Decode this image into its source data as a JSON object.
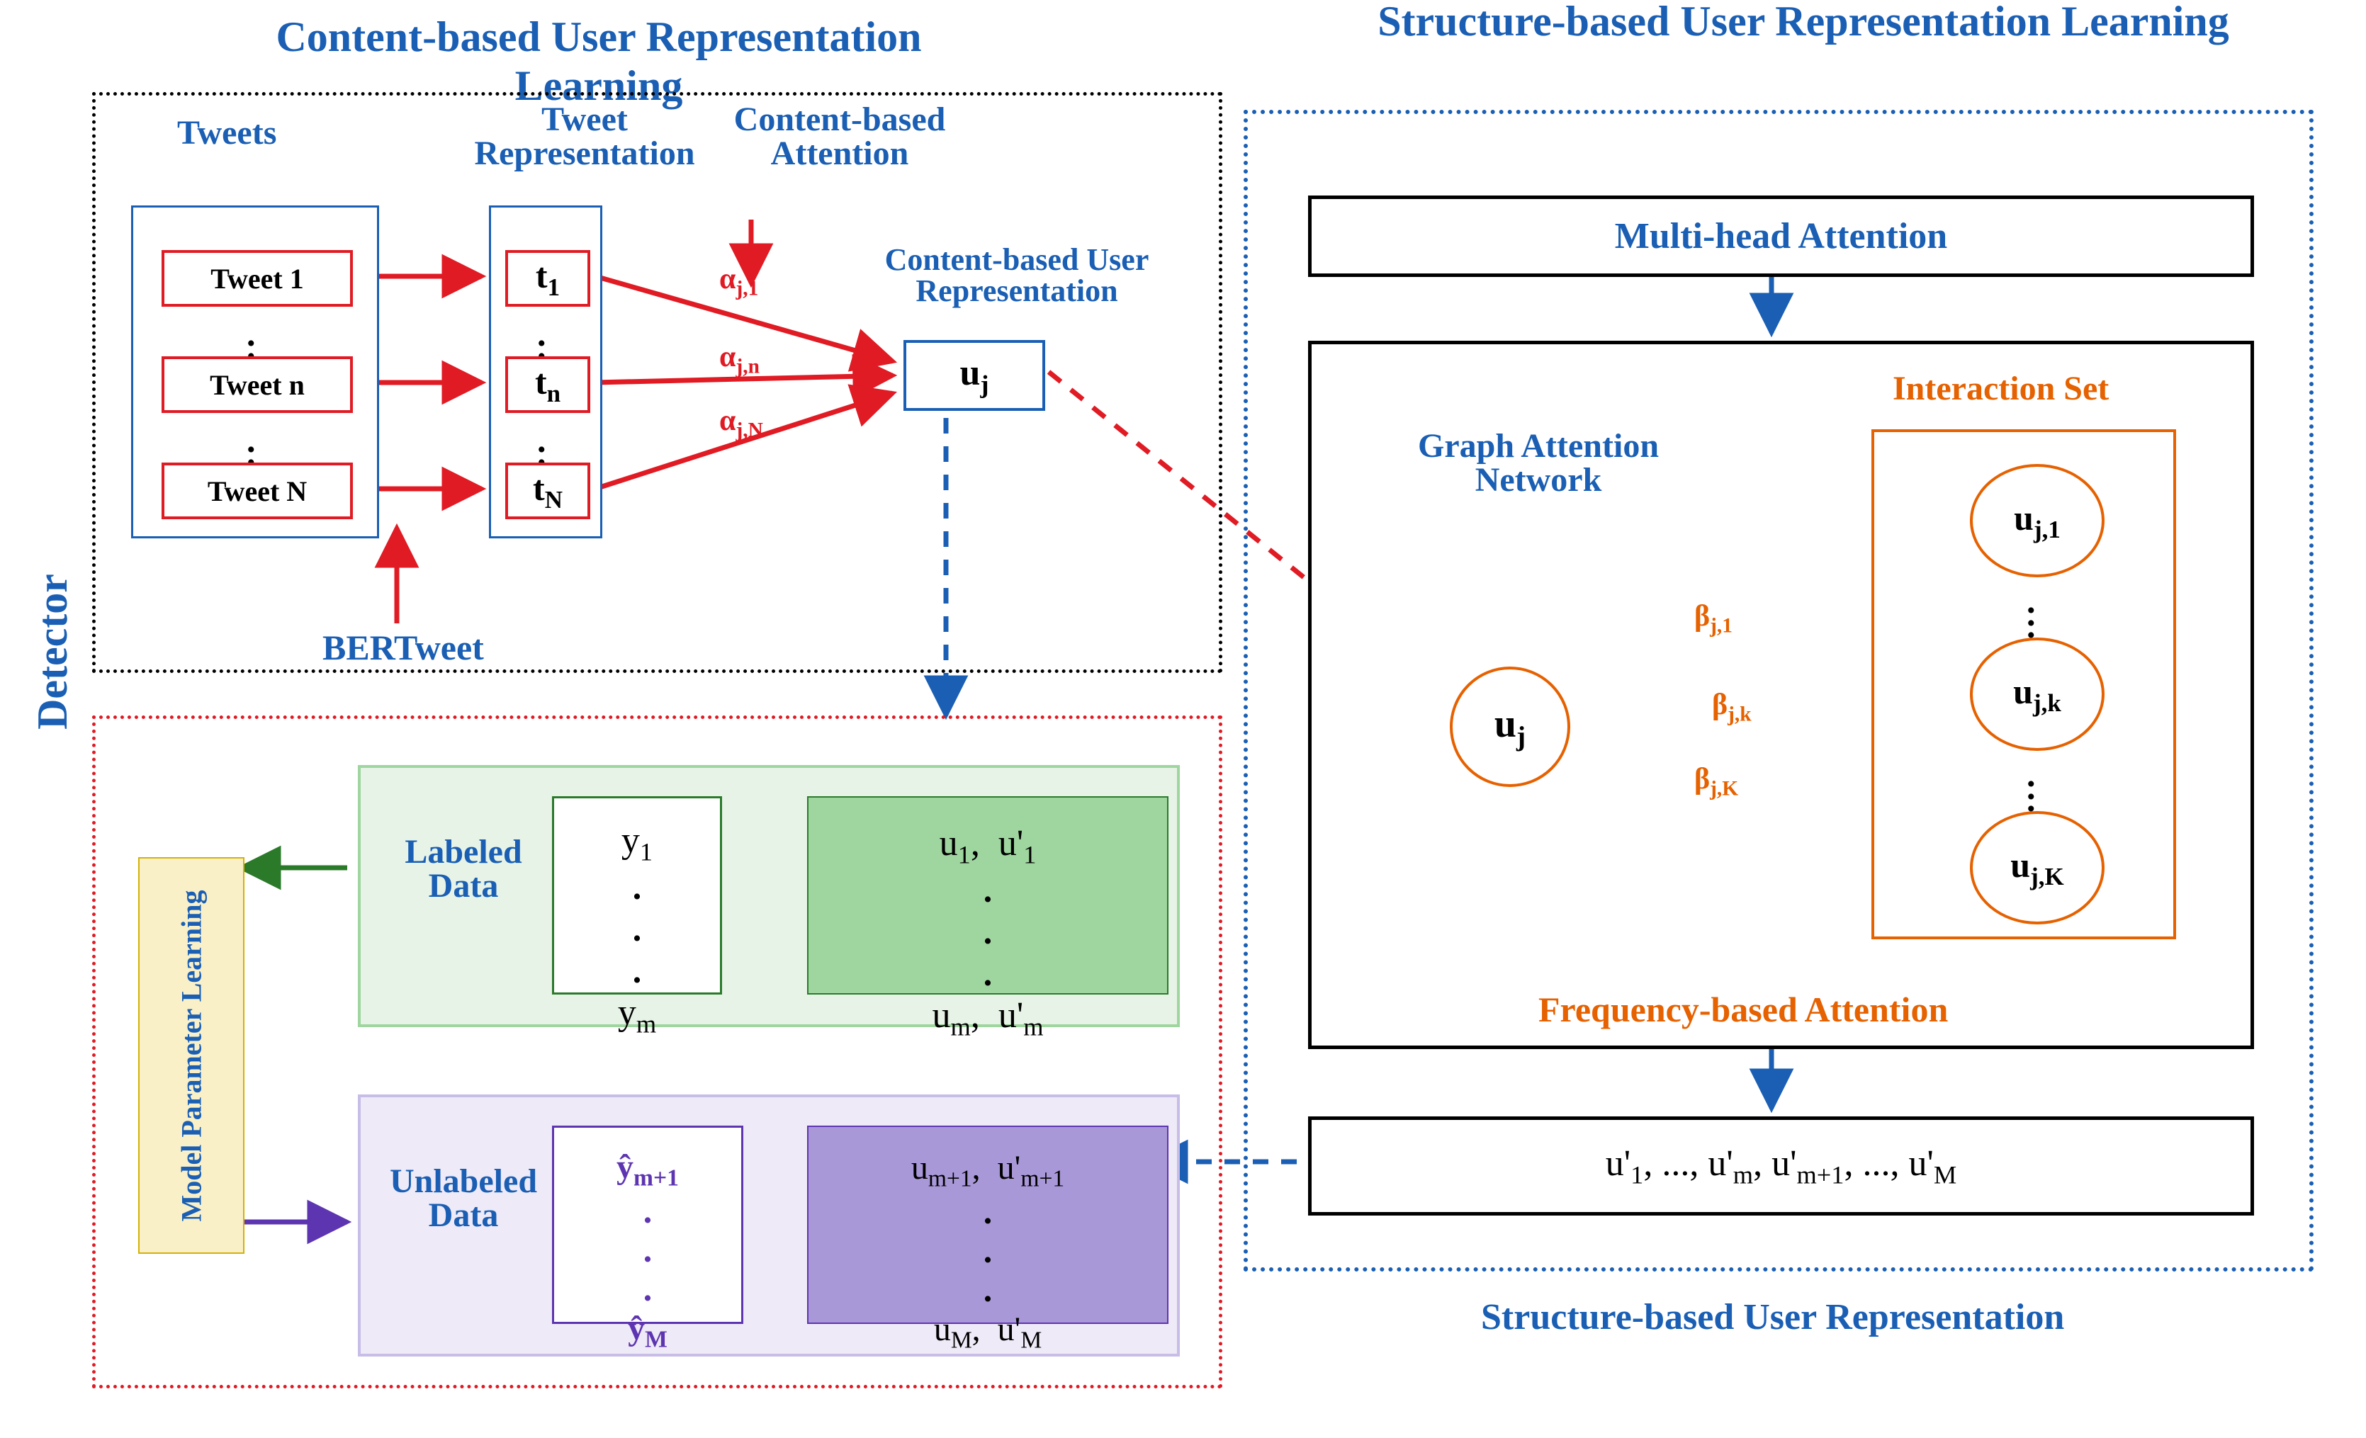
{
  "titles": {
    "content_learning": "Content-based User Representation Learning",
    "structure_learning": "Structure-based User Representation Learning",
    "detector": "Detector"
  },
  "content": {
    "tweets_label": "Tweets",
    "tweet_rep_label": "Tweet Representation",
    "content_attention_label": "Content-based Attention",
    "content_user_rep_label": "Content-based User Representation",
    "bertweet_label": "BERTweet",
    "tweets": [
      "Tweet 1",
      "Tweet n",
      "Tweet N"
    ],
    "treps": [
      "t_1",
      "t_n",
      "t_N"
    ],
    "alphas": [
      "α_j,1",
      "α_j,n",
      "α_j,N"
    ],
    "uj": "u_j"
  },
  "structure": {
    "multi_head_label": "Multi-head Attention",
    "gat_label": "Graph Attention Network",
    "interaction_set_label": "Interaction Set",
    "freq_attention_label": "Frequency-based Attention",
    "structure_user_rep_label": "Structure-based User Representation",
    "center_node": "u_j",
    "neighbors": [
      "u_j,1",
      "u_j,k",
      "u_j,K"
    ],
    "betas": [
      "β_j,1",
      "β_j,k",
      "β_j,K"
    ],
    "output_reps": "u'_1, ..., u'_m, u'_m+1, ..., u'_M"
  },
  "detector": {
    "labeled_label": "Labeled Data",
    "unlabeled_label": "Unlabeled Data",
    "model_param_label": "Model Parameter Learning",
    "labeled_y": [
      "y_1",
      "y_m"
    ],
    "labeled_u": [
      "u_1,  u'_1",
      "u_m,  u'_m"
    ],
    "unlabeled_y": [
      "ŷ_m+1",
      "ŷ_M"
    ],
    "unlabeled_u": [
      "u_m+1,  u'_m+1",
      "u_M,  u'_M"
    ]
  },
  "colors": {
    "blue": "#1a5fb4",
    "red": "#e01b24",
    "orange": "#e66100",
    "green_dark": "#2a7a2a",
    "green_light": "#9fd59f",
    "purple_dark": "#5e35b1",
    "purple_light": "#a998d8",
    "yellow_bg": "#faf0c8"
  }
}
